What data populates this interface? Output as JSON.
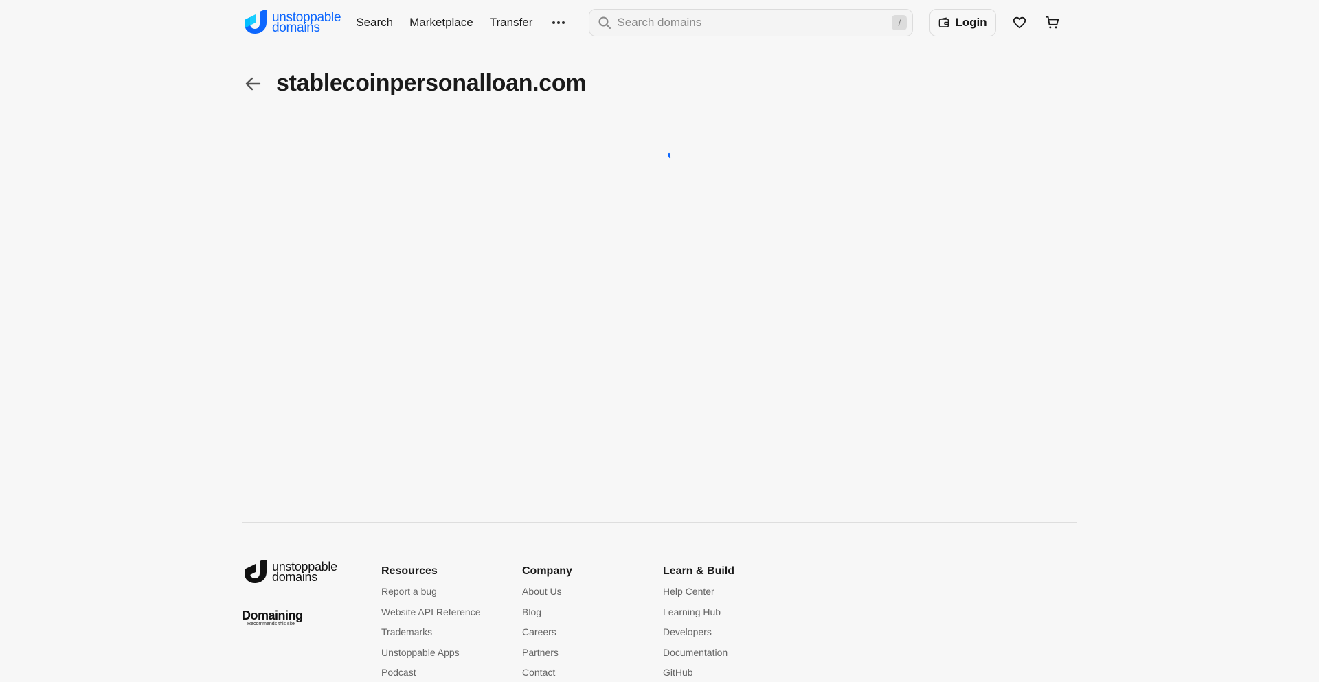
{
  "header": {
    "logo_line1": "unstoppable",
    "logo_line2": "domains",
    "nav": [
      "Search",
      "Marketplace",
      "Transfer"
    ],
    "search_placeholder": "Search domains",
    "search_shortcut": "/",
    "login_label": "Login"
  },
  "page": {
    "domain": "stablecoinpersonalloan.com"
  },
  "footer": {
    "logo_line1": "unstoppable",
    "logo_line2": "domains",
    "badge_word": "Domaining",
    "badge_sub": "Recommends this site",
    "columns": [
      {
        "title": "Resources",
        "links": [
          "Report a bug",
          "Website API Reference",
          "Trademarks",
          "Unstoppable Apps",
          "Podcast"
        ]
      },
      {
        "title": "Company",
        "links": [
          "About Us",
          "Blog",
          "Careers",
          "Partners",
          "Contact"
        ]
      },
      {
        "title": "Learn & Build",
        "links": [
          "Help Center",
          "Learning Hub",
          "Developers",
          "Documentation",
          "GitHub"
        ]
      }
    ]
  },
  "colors": {
    "brand": "#0d67fe",
    "background": "#f7f7f7",
    "text": "#1a1a1a"
  }
}
